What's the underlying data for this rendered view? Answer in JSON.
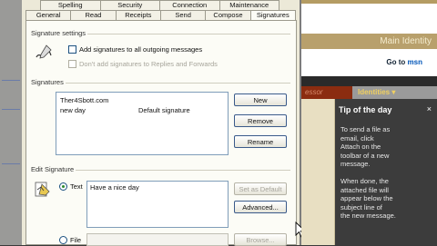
{
  "dialog": {
    "tabs_back": [
      "Spelling",
      "Security",
      "Connection",
      "Maintenance"
    ],
    "tabs_front": [
      "General",
      "Read",
      "Receipts",
      "Send",
      "Compose",
      "Signatures"
    ],
    "signature_settings": {
      "label": "Signature settings",
      "add_all_label": "Add signatures to all outgoing messages",
      "no_replies_label": "Don't add signatures to Replies and Forwards"
    },
    "signatures": {
      "label": "Signatures",
      "items": [
        {
          "name": "Ther4Sbott.com",
          "default": ""
        },
        {
          "name": "new day",
          "default": "Default signature"
        }
      ],
      "new_label": "New",
      "remove_label": "Remove",
      "rename_label": "Rename"
    },
    "edit_signature": {
      "label": "Edit Signature",
      "text_option": "Text",
      "text_value": "Have a nice day",
      "set_default_label": "Set as Default",
      "advanced_label": "Advanced...",
      "file_option": "File",
      "browse_label": "Browse..."
    }
  },
  "right": {
    "identity_title": "Main Identity",
    "goto_prefix": "Go to",
    "goto_brand": "msn",
    "header_left": "essor",
    "header_right": "Identities ▾",
    "tip_title": "Tip of the day",
    "tip_close": "×",
    "tip_body": "To send a file as\nemail, click\nAttach on the\ntoolbar of a new\nmessage.\n\nWhen done, the\nattached file will\nappear below the\nsubject line of\nthe new message."
  }
}
